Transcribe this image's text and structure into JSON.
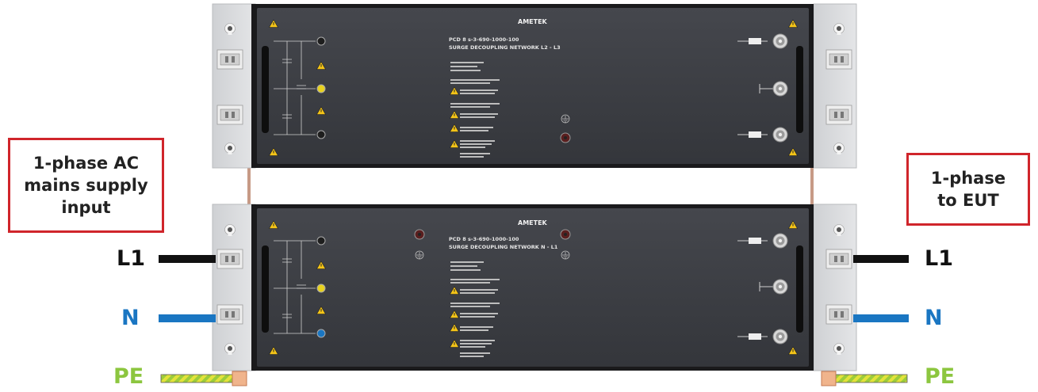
{
  "callouts": {
    "input": "1-phase AC\nmains supply\ninput",
    "output": "1-phase\nto EUT"
  },
  "wires": {
    "left_l1": "L1",
    "left_n": "N",
    "left_pe": "PE",
    "right_l1": "L1",
    "right_n": "N",
    "right_pe": "PE"
  },
  "units": [
    {
      "logo": "AMETEK",
      "model": "PCD 8 s-3-690-1000-100",
      "name": "SURGE DECOUPLING NETWORK L2 - L3"
    },
    {
      "logo": "AMETEK",
      "model": "PCD 8 s-3-690-1000-100",
      "name": "SURGE DECOUPLING NETWORK N - L1"
    }
  ],
  "colors": {
    "callout_border": "#d0252b",
    "l1_wire": "#111111",
    "n_wire": "#1a76c2",
    "pe_wire_a": "#9ccc3a",
    "pe_wire_b": "#e3e33a",
    "panel": "#3b3d43",
    "chassis": "#d4d6d9",
    "label_l1": "#111111",
    "label_n": "#1a76c2",
    "label_pe": "#8cc63f"
  }
}
